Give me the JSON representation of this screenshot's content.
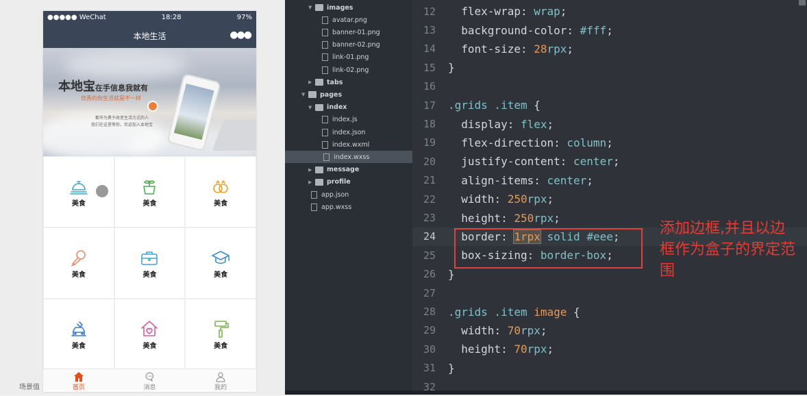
{
  "simulator": {
    "footer_label": "场景值",
    "status_bar": {
      "carrier": "●●●●● WeChat",
      "time": "18:28",
      "battery": "97%"
    },
    "nav_title": "本地生活",
    "nav_more": "●●●",
    "banner": {
      "title_main": "本地宝",
      "title_sub": "在手信息我就有",
      "slogan": "优秀的你生活就是不一样",
      "desc_line1": "都市为勇于改变生活方式的人",
      "desc_line2": "我们在这里等你，欢迎加入本地宝"
    },
    "grid_items": [
      {
        "label": "美食",
        "icon": "dining-bell-icon",
        "color": "#3aa8c9"
      },
      {
        "label": "美食",
        "icon": "flower-pot-icon",
        "color": "#4cae4c"
      },
      {
        "label": "美食",
        "icon": "wedding-rings-icon",
        "color": "#f0a020"
      },
      {
        "label": "美食",
        "icon": "microphone-icon",
        "color": "#f08a6a"
      },
      {
        "label": "美食",
        "icon": "briefcase-icon",
        "color": "#3aa8d8"
      },
      {
        "label": "美食",
        "icon": "graduation-cap-icon",
        "color": "#3a8fd8"
      },
      {
        "label": "美食",
        "icon": "car-repair-icon",
        "color": "#3a7fc8"
      },
      {
        "label": "美食",
        "icon": "house-heart-icon",
        "color": "#e05a9a"
      },
      {
        "label": "美食",
        "icon": "paint-roller-icon",
        "color": "#7ab84a"
      }
    ],
    "tabs": [
      {
        "label": "首页",
        "icon": "home-icon",
        "active": true
      },
      {
        "label": "消息",
        "icon": "chat-bubble-icon",
        "active": false
      },
      {
        "label": "我的",
        "icon": "user-icon",
        "active": false
      }
    ]
  },
  "explorer": {
    "nodes": [
      {
        "name": "images",
        "type": "folder",
        "open": true,
        "level": 1
      },
      {
        "name": "avatar.png",
        "type": "image",
        "level": 2
      },
      {
        "name": "banner-01.png",
        "type": "image",
        "level": 2
      },
      {
        "name": "banner-02.png",
        "type": "image",
        "level": 2
      },
      {
        "name": "link-01.png",
        "type": "image",
        "level": 2
      },
      {
        "name": "link-02.png",
        "type": "image",
        "level": 2
      },
      {
        "name": "tabs",
        "type": "folder",
        "open": false,
        "level": 1
      },
      {
        "name": "pages",
        "type": "folder",
        "open": true,
        "level": 0
      },
      {
        "name": "index",
        "type": "folder",
        "open": true,
        "level": 1
      },
      {
        "name": "index.js",
        "type": "js",
        "level": 2
      },
      {
        "name": "index.json",
        "type": "json",
        "level": 2
      },
      {
        "name": "index.wxml",
        "type": "wxml",
        "level": 2
      },
      {
        "name": "index.wxss",
        "type": "wxss",
        "level": 2,
        "selected": true
      },
      {
        "name": "message",
        "type": "folder",
        "open": false,
        "level": 1
      },
      {
        "name": "profile",
        "type": "folder",
        "open": false,
        "level": 1
      },
      {
        "name": "app.json",
        "type": "json",
        "level": 0
      },
      {
        "name": "app.wxss",
        "type": "file",
        "level": 0
      }
    ]
  },
  "editor": {
    "current_line": 24,
    "lines": [
      {
        "n": "12",
        "tokens": [
          [
            "p",
            "  flex-wrap"
          ],
          [
            "b",
            ": "
          ],
          [
            "v",
            "wrap"
          ],
          [
            "b",
            ";"
          ]
        ]
      },
      {
        "n": "13",
        "tokens": [
          [
            "p",
            "  background-color"
          ],
          [
            "b",
            ": "
          ],
          [
            "v",
            "#fff"
          ],
          [
            "b",
            ";"
          ]
        ]
      },
      {
        "n": "14",
        "tokens": [
          [
            "p",
            "  font-size"
          ],
          [
            "b",
            ": "
          ],
          [
            "n",
            "28"
          ],
          [
            "v",
            "rpx"
          ],
          [
            "b",
            ";"
          ]
        ]
      },
      {
        "n": "15",
        "tokens": [
          [
            "b",
            "}"
          ]
        ]
      },
      {
        "n": "16",
        "tokens": []
      },
      {
        "n": "17",
        "tokens": [
          [
            "s",
            ".grids .item"
          ],
          [
            "b",
            " {"
          ]
        ]
      },
      {
        "n": "18",
        "tokens": [
          [
            "p",
            "  display"
          ],
          [
            "b",
            ": "
          ],
          [
            "v",
            "flex"
          ],
          [
            "b",
            ";"
          ]
        ]
      },
      {
        "n": "19",
        "tokens": [
          [
            "p",
            "  flex-direction"
          ],
          [
            "b",
            ": "
          ],
          [
            "v",
            "column"
          ],
          [
            "b",
            ";"
          ]
        ]
      },
      {
        "n": "20",
        "tokens": [
          [
            "p",
            "  justify-content"
          ],
          [
            "b",
            ": "
          ],
          [
            "v",
            "center"
          ],
          [
            "b",
            ";"
          ]
        ]
      },
      {
        "n": "21",
        "tokens": [
          [
            "p",
            "  align-items"
          ],
          [
            "b",
            ": "
          ],
          [
            "v",
            "center"
          ],
          [
            "b",
            ";"
          ]
        ]
      },
      {
        "n": "22",
        "tokens": [
          [
            "p",
            "  width"
          ],
          [
            "b",
            ": "
          ],
          [
            "n",
            "250"
          ],
          [
            "v",
            "rpx"
          ],
          [
            "b",
            ";"
          ]
        ]
      },
      {
        "n": "23",
        "tokens": [
          [
            "p",
            "  height"
          ],
          [
            "b",
            ": "
          ],
          [
            "n",
            "250"
          ],
          [
            "v",
            "rpx"
          ],
          [
            "b",
            ";"
          ]
        ]
      },
      {
        "n": "24",
        "tokens": [
          [
            "p",
            "  border"
          ],
          [
            "b",
            ": "
          ],
          [
            "x",
            "1rpx"
          ],
          [
            "b",
            " "
          ],
          [
            "v",
            "solid"
          ],
          [
            "b",
            " "
          ],
          [
            "v",
            "#eee"
          ],
          [
            "b",
            ";"
          ]
        ]
      },
      {
        "n": "25",
        "tokens": [
          [
            "p",
            "  box-sizing"
          ],
          [
            "b",
            ": "
          ],
          [
            "v",
            "border-box"
          ],
          [
            "b",
            ";"
          ]
        ]
      },
      {
        "n": "26",
        "tokens": [
          [
            "b",
            "}"
          ]
        ]
      },
      {
        "n": "27",
        "tokens": []
      },
      {
        "n": "28",
        "tokens": [
          [
            "s",
            ".grids .item "
          ],
          [
            "t",
            "image"
          ],
          [
            "b",
            " {"
          ]
        ]
      },
      {
        "n": "29",
        "tokens": [
          [
            "p",
            "  width"
          ],
          [
            "b",
            ": "
          ],
          [
            "n",
            "70"
          ],
          [
            "v",
            "rpx"
          ],
          [
            "b",
            ";"
          ]
        ]
      },
      {
        "n": "30",
        "tokens": [
          [
            "p",
            "  height"
          ],
          [
            "b",
            ": "
          ],
          [
            "n",
            "70"
          ],
          [
            "v",
            "rpx"
          ],
          [
            "b",
            ";"
          ]
        ]
      },
      {
        "n": "31",
        "tokens": [
          [
            "b",
            "}"
          ]
        ]
      },
      {
        "n": "32",
        "tokens": []
      }
    ],
    "annotation": "添加边框,并且以边框作为盒子的界定范围"
  }
}
